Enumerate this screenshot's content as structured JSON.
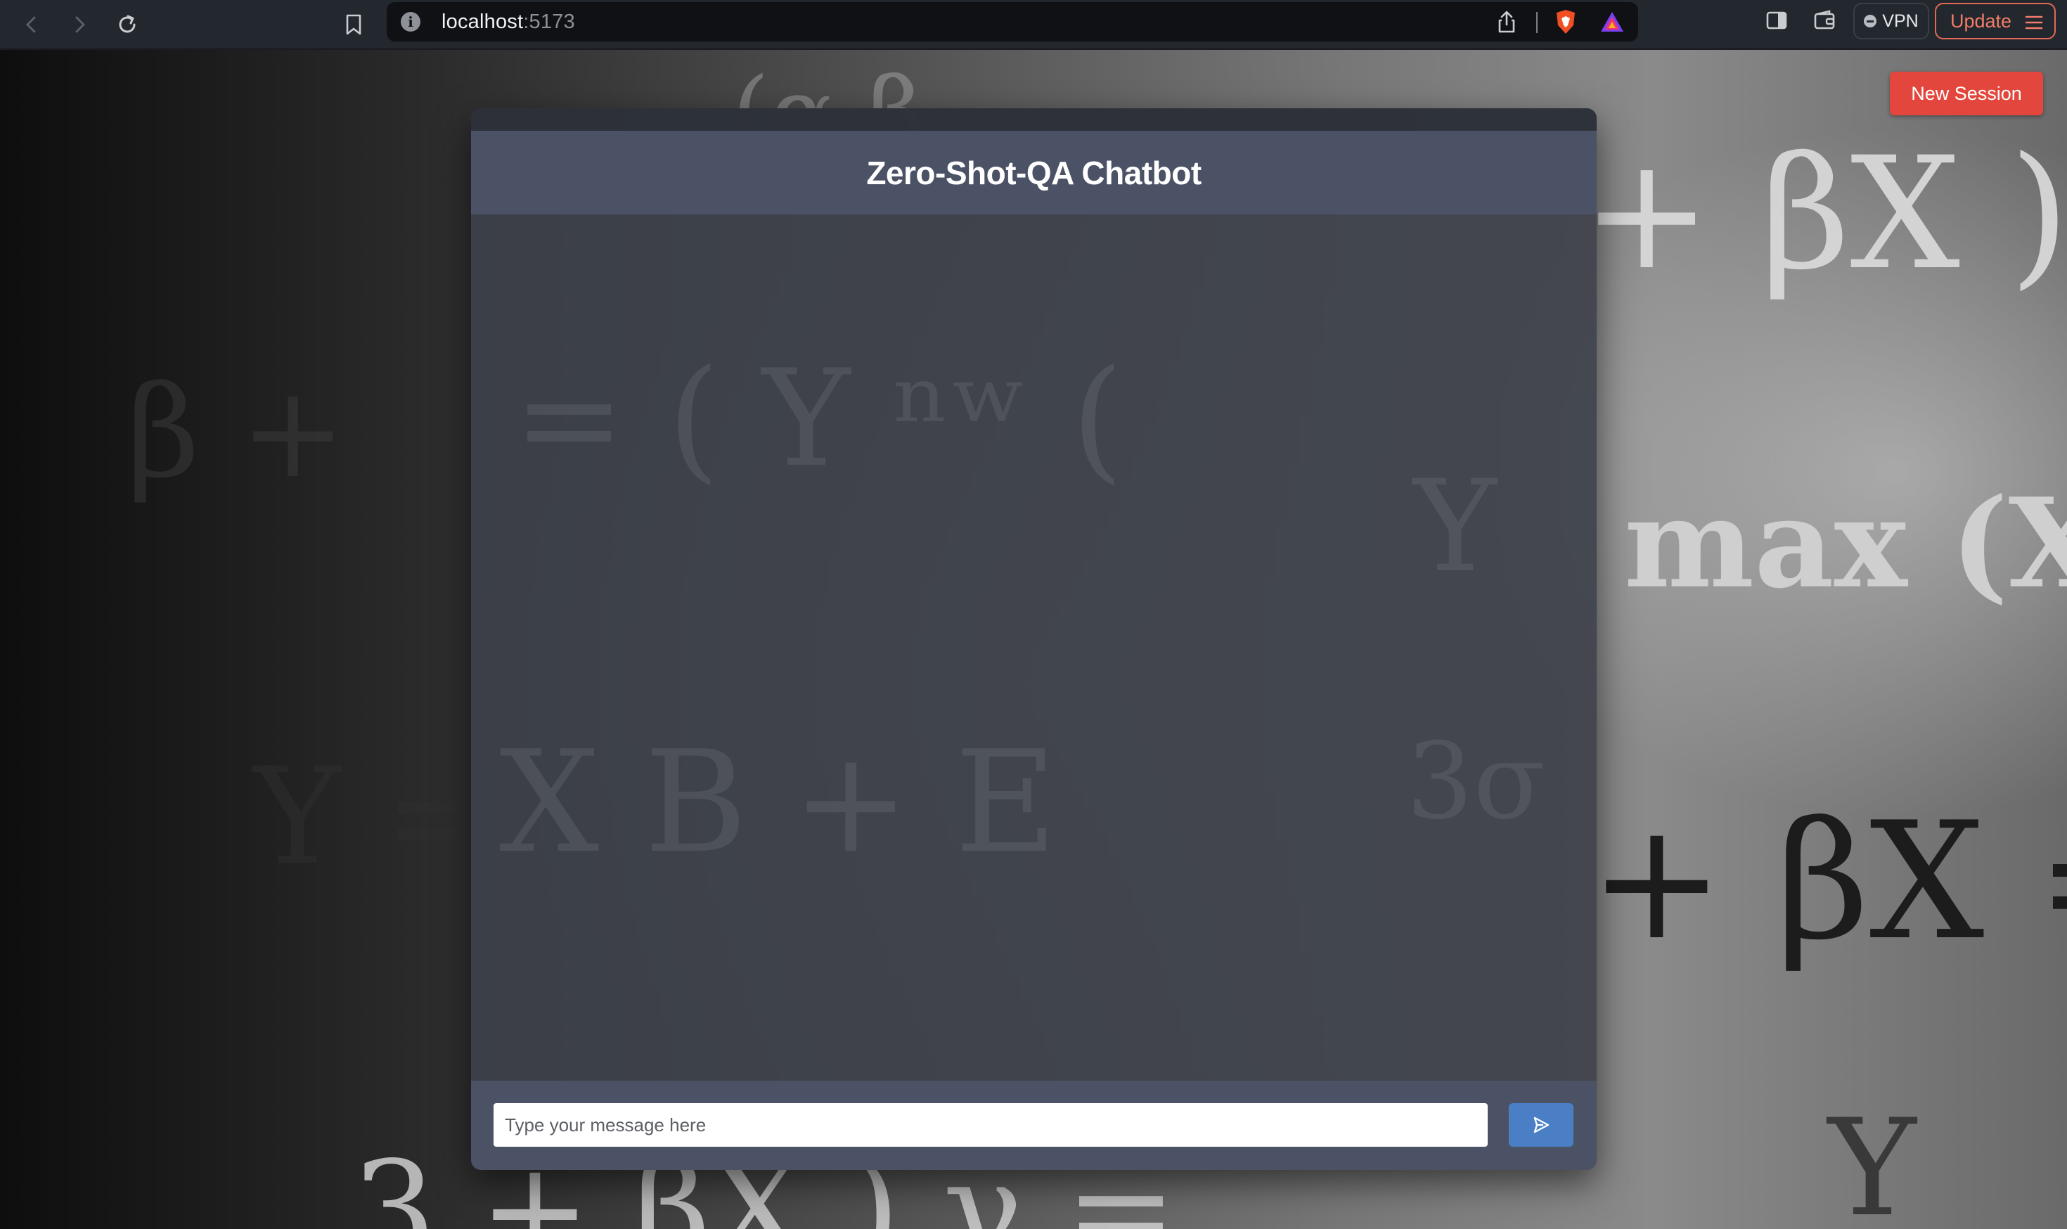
{
  "browser": {
    "url_host": "localhost",
    "url_port": ":5173",
    "vpn_label": "VPN",
    "update_label": "Update",
    "icons": [
      "back-icon",
      "forward-icon",
      "reload-icon",
      "bookmark-icon",
      "site-info-icon",
      "share-icon",
      "brave-shield-icon",
      "brave-rewards-icon",
      "sidebar-icon",
      "wallet-icon",
      "menu-icon"
    ]
  },
  "page": {
    "new_session_label": "New Session",
    "colors": {
      "new_session": "#e2463c",
      "header": "#4c5265",
      "send_button": "#4a7fc6"
    }
  },
  "chat": {
    "title": "Zero-Shot-QA Chatbot",
    "input_value": "",
    "input_placeholder": "Type your message here",
    "send_icon": "send-icon"
  }
}
